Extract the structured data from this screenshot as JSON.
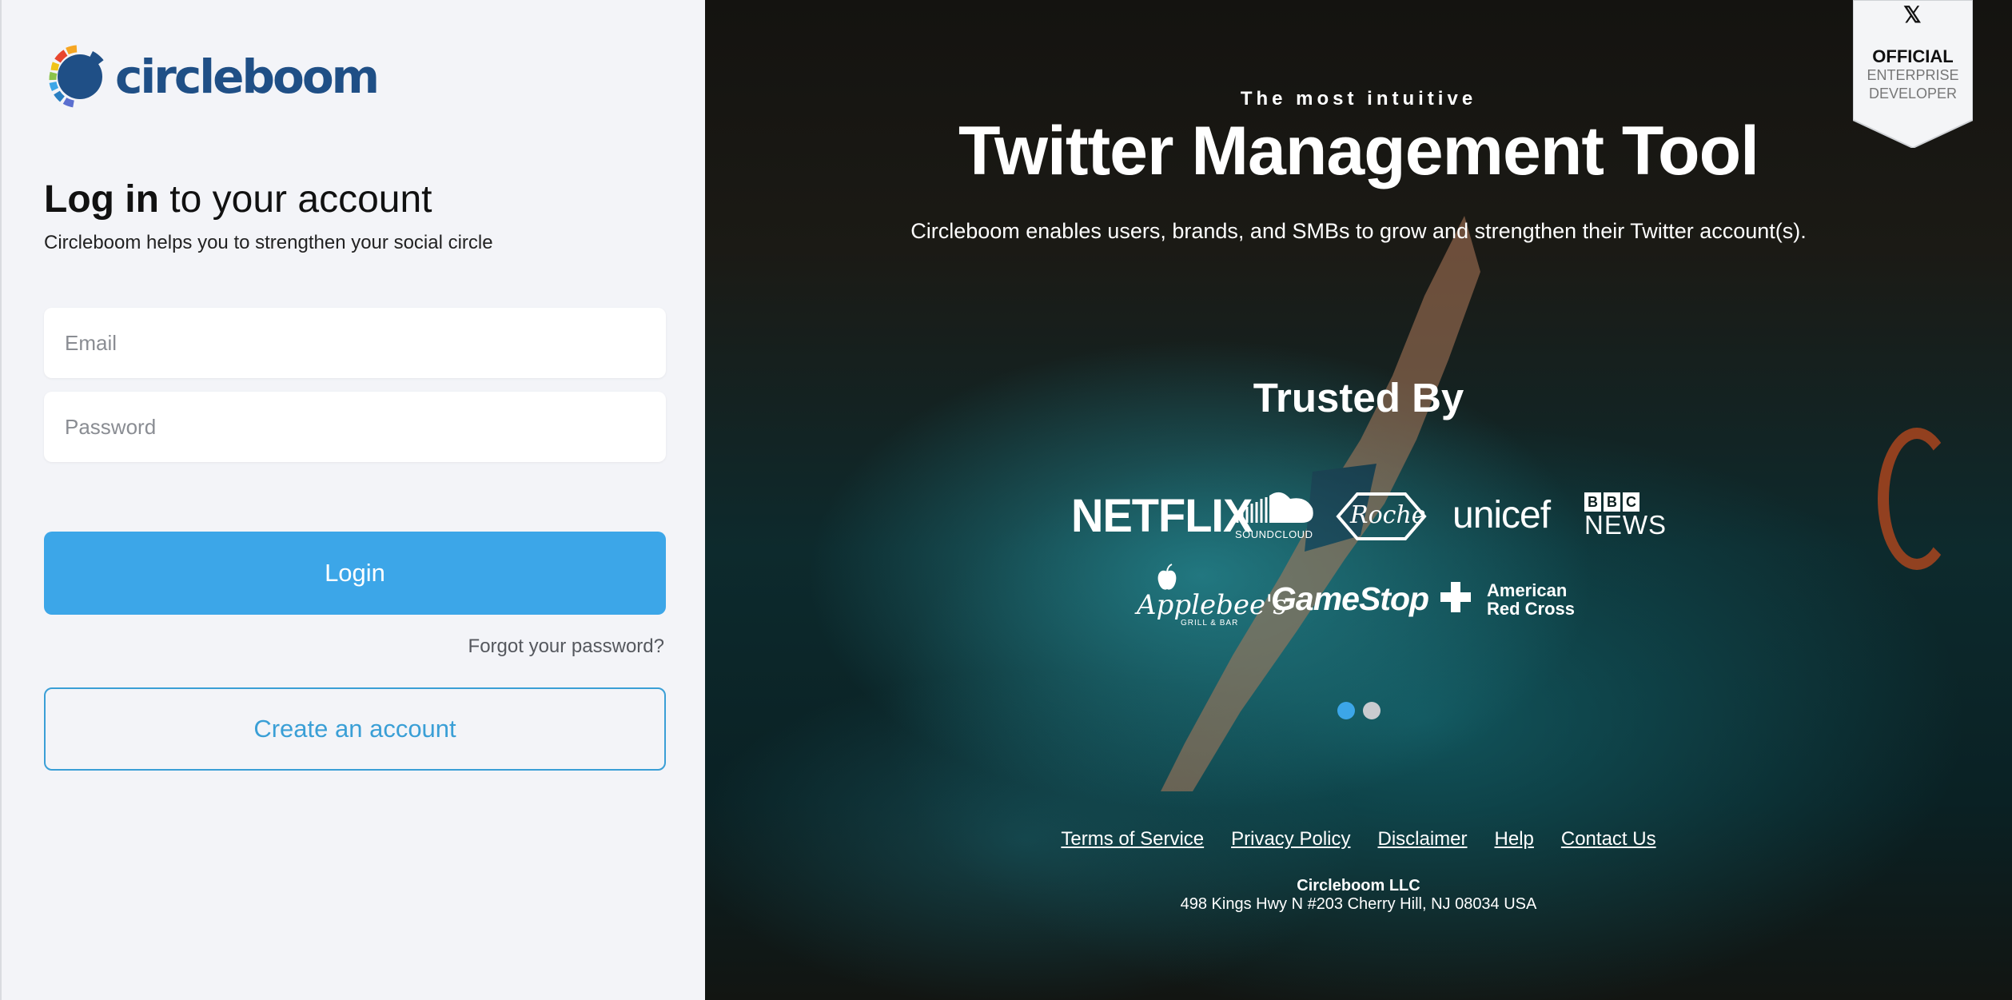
{
  "brand": {
    "name": "circleboom"
  },
  "login": {
    "heading_bold": "Log in",
    "heading_rest": " to your account",
    "subtitle": "Circleboom helps you to strengthen your social circle",
    "email_placeholder": "Email",
    "password_placeholder": "Password",
    "login_label": "Login",
    "forgot_label": "Forgot your password?",
    "create_label": "Create an account"
  },
  "hero": {
    "tagline": "The most intuitive",
    "title": "Twitter Management Tool",
    "subtitle": "Circleboom enables users, brands, and SMBs to grow and strengthen their Twitter account(s)."
  },
  "badge": {
    "icon": "x-icon",
    "title": "OFFICIAL",
    "line1": "ENTERPRISE",
    "line2": "DEVELOPER"
  },
  "trusted": {
    "title": "Trusted By",
    "logos": {
      "netflix": "NETFLIX",
      "soundcloud": "SOUNDCLOUD",
      "roche": "Roche",
      "unicef": "unicef",
      "bbc_b1": "B",
      "bbc_b2": "B",
      "bbc_c": "C",
      "bbc_news": "NEWS",
      "applebees": "Applebee's",
      "applebees_sub": "GRILL & BAR",
      "gamestop": "GameStop",
      "redcross_1": "American",
      "redcross_2": "Red Cross"
    }
  },
  "carousel": {
    "active_index": 0,
    "count": 2
  },
  "footer": {
    "links": {
      "terms": "Terms of Service",
      "privacy": "Privacy Policy",
      "disclaimer": "Disclaimer",
      "help": "Help",
      "contact": "Contact Us"
    },
    "company": "Circleboom LLC",
    "address": "498 Kings Hwy N #203 Cherry Hill, NJ 08034 USA"
  },
  "colors": {
    "primary": "#3ca6e8",
    "logo_text": "#1f4f86",
    "panel_bg": "#f3f4f8"
  }
}
